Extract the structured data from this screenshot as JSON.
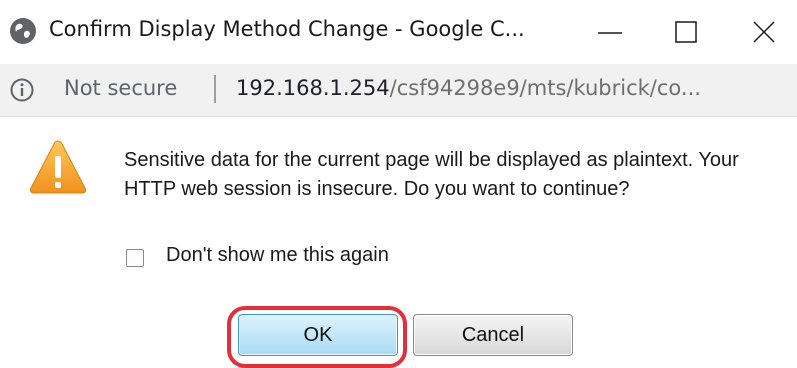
{
  "window": {
    "title": "Confirm Display Method Change - Google C...",
    "controls": {
      "minimize": "minimize-icon",
      "maximize": "maximize-icon",
      "close": "close-icon"
    }
  },
  "address_bar": {
    "security_label": "Not secure",
    "url_host": "192.168.1.254",
    "url_path": "/csf94298e9/mts/kubrick/co..."
  },
  "dialog": {
    "message": "Sensitive data for the current page will be displayed as plaintext. Your HTTP web session is insecure. Do you want to continue?",
    "checkbox_label": "Don't show me this again",
    "checkbox_checked": false,
    "ok_label": "OK",
    "cancel_label": "Cancel"
  },
  "colors": {
    "warning": "#f5a623",
    "highlight": "#e0303a",
    "ok_button": "#a9dbf5"
  }
}
